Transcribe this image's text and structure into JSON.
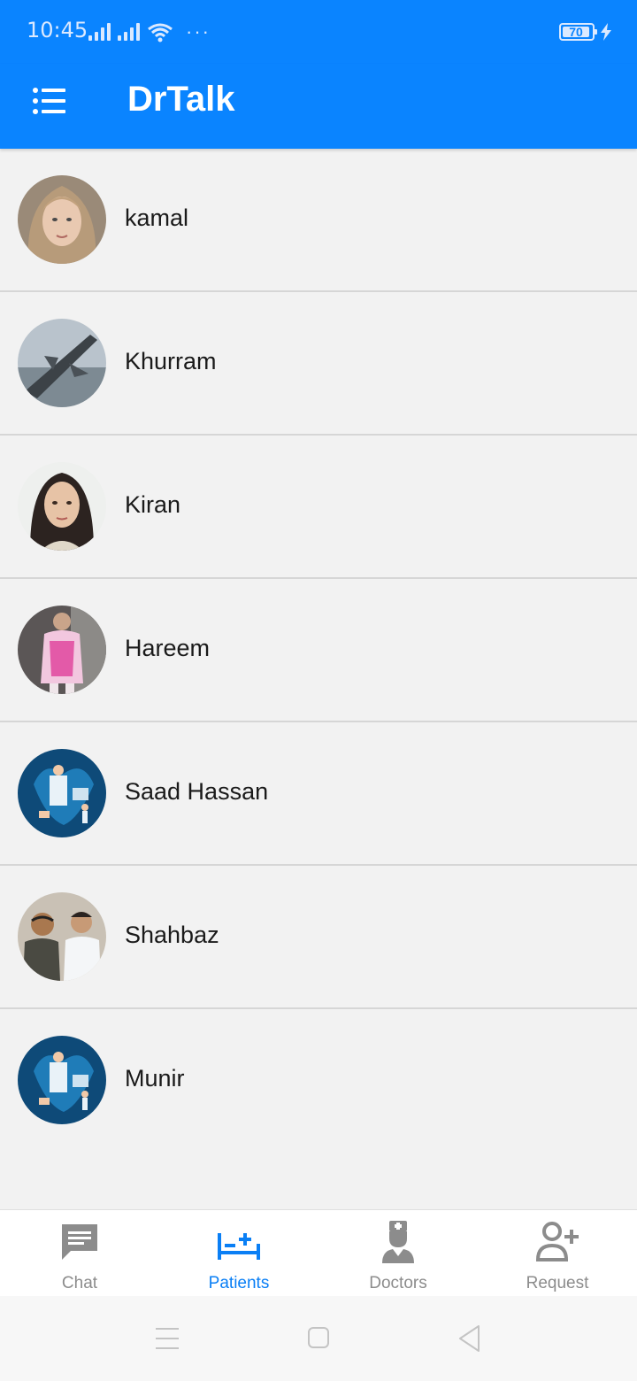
{
  "status": {
    "time": "10:45",
    "battery": "70"
  },
  "app": {
    "title": "DrTalk",
    "accent": "#0a84ff"
  },
  "patients": [
    {
      "name": "kamal",
      "avatar": "woman-portrait-avatar"
    },
    {
      "name": "Khurram",
      "avatar": "fighter-jet-avatar"
    },
    {
      "name": "Kiran",
      "avatar": "woman-portrait-avatar"
    },
    {
      "name": "Hareem",
      "avatar": "child-photo-avatar"
    },
    {
      "name": "Saad Hassan",
      "avatar": "medical-illustration-avatar"
    },
    {
      "name": "Shahbaz",
      "avatar": "two-men-photo-avatar"
    },
    {
      "name": "Munir",
      "avatar": "medical-illustration-avatar"
    }
  ],
  "nav": [
    {
      "label": "Chat",
      "icon": "chat-icon",
      "active": false
    },
    {
      "label": "Patients",
      "icon": "hospital-bed-icon",
      "active": true
    },
    {
      "label": "Doctors",
      "icon": "doctor-icon",
      "active": false
    },
    {
      "label": "Request",
      "icon": "add-person-icon",
      "active": false
    }
  ]
}
